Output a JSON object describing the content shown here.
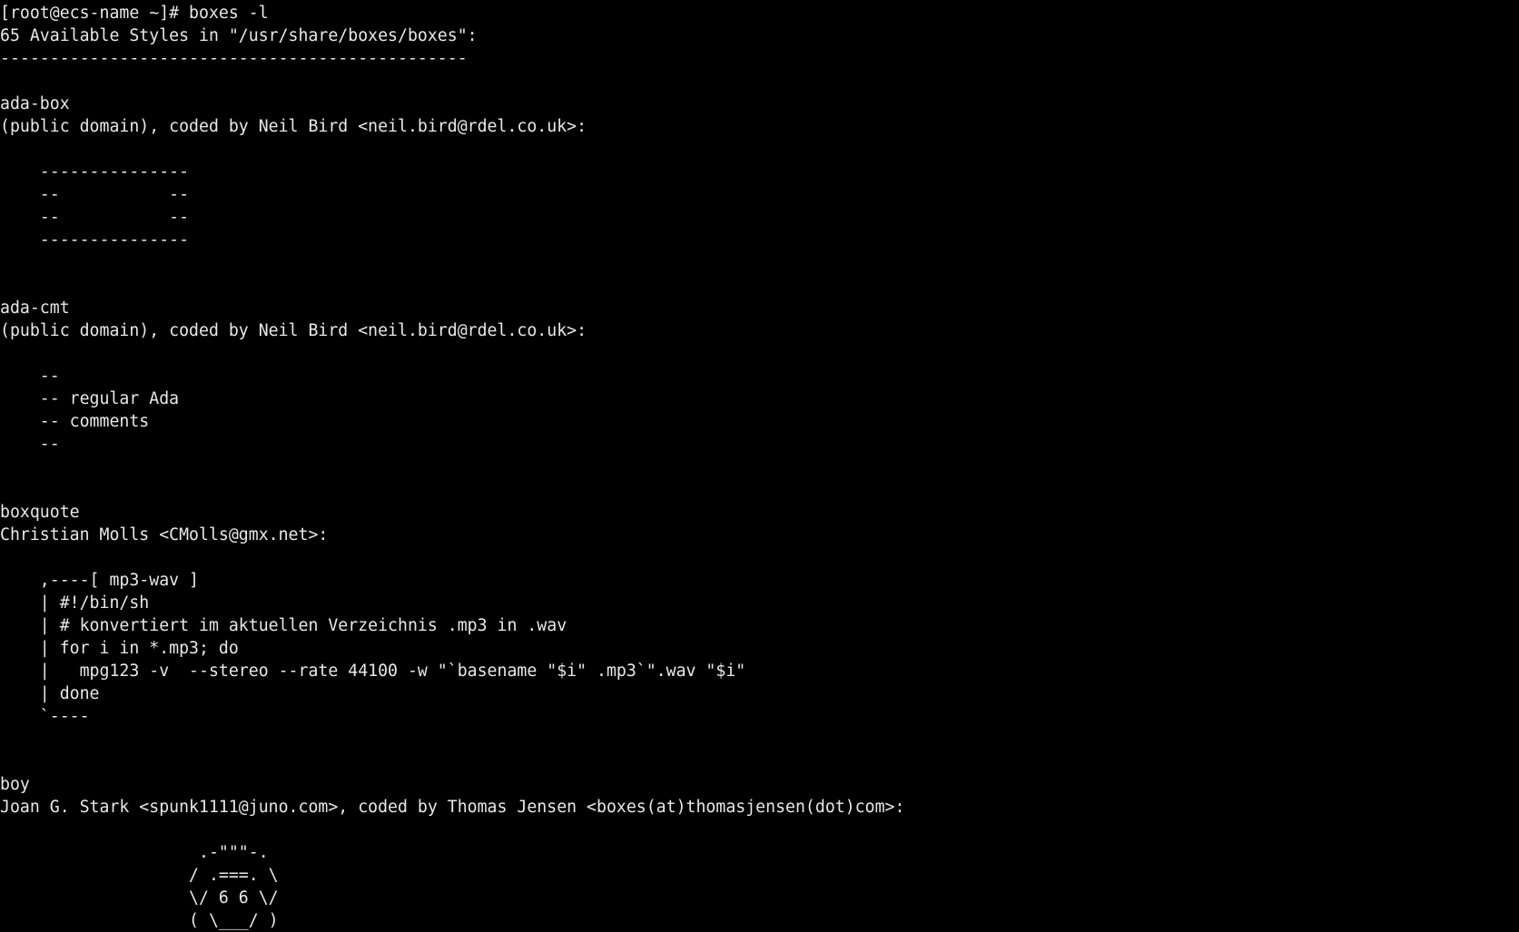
{
  "colors": {
    "background": "#000000",
    "foreground": "#e8e8e8"
  },
  "terminal": {
    "lines": [
      "[root@ecs-name ~]# boxes -l",
      "65 Available Styles in \"/usr/share/boxes/boxes\":",
      "-----------------------------------------------",
      "",
      "ada-box",
      "(public domain), coded by Neil Bird <neil.bird@rdel.co.uk>:",
      "",
      "    ---------------",
      "    --           --",
      "    --           --",
      "    ---------------",
      "",
      "",
      "ada-cmt",
      "(public domain), coded by Neil Bird <neil.bird@rdel.co.uk>:",
      "",
      "    --",
      "    -- regular Ada",
      "    -- comments",
      "    --",
      "",
      "",
      "boxquote",
      "Christian Molls <CMolls@gmx.net>:",
      "",
      "    ,----[ mp3-wav ]",
      "    | #!/bin/sh",
      "    | # konvertiert im aktuellen Verzeichnis .mp3 in .wav",
      "    | for i in *.mp3; do",
      "    |   mpg123 -v  --stereo --rate 44100 -w \"`basename \"$i\" .mp3`\".wav \"$i\"",
      "    | done",
      "    `----",
      "",
      "",
      "boy",
      "Joan G. Stark <spunk1111@juno.com>, coded by Thomas Jensen <boxes(at)thomasjensen(dot)com>:",
      "",
      "                    .-\"\"\"-.",
      "                   / .===. \\",
      "                   \\/ 6 6 \\/",
      "                   ( \\___/ )"
    ]
  }
}
